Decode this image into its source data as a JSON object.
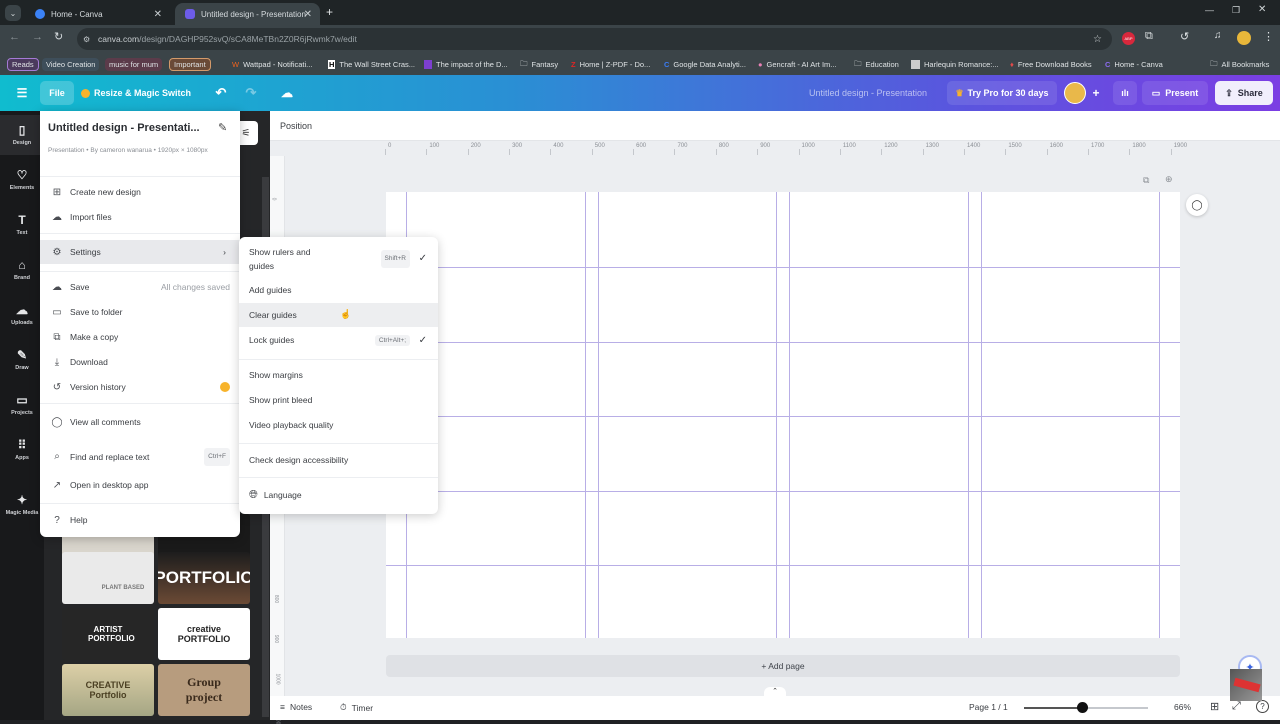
{
  "browser": {
    "tabs": [
      {
        "title": "Home - Canva",
        "active": false
      },
      {
        "title": "Untitled design - Presentation",
        "active": true
      }
    ],
    "new_tab_label": "+",
    "url_host": "canva.com",
    "url_path": "/design/DAGHP952svQ/sCA8MeTBn2Z0R6jRwmk7w/edit",
    "bookmarks_chips": [
      "Reads",
      "Video Creation",
      "music for mum",
      "Important"
    ],
    "bookmarks": [
      "Wattpad - Notificati...",
      "The Wall Street Cras...",
      "The impact of the D...",
      "Fantasy",
      "Home | Z-PDF - Do...",
      "Google Data Analyti...",
      "Gencraft - AI Art Im...",
      "Education",
      "Harlequin Romance:...",
      "Free Download Books",
      "Home - Canva"
    ],
    "all_bookmarks_label": "All Bookmarks"
  },
  "header": {
    "file_label": "File",
    "resize_label": "Resize & Magic Switch",
    "doc_title": "Untitled design - Presentation",
    "try_pro_label": "Try Pro for 30 days",
    "present_label": "Present",
    "share_label": "Share"
  },
  "rail": {
    "items": [
      {
        "label": "Design",
        "icon": "▯"
      },
      {
        "label": "Elements",
        "icon": "♡△"
      },
      {
        "label": "Text",
        "icon": "T"
      },
      {
        "label": "Brand",
        "icon": "⌂"
      },
      {
        "label": "Uploads",
        "icon": "☁"
      },
      {
        "label": "Draw",
        "icon": "✎"
      },
      {
        "label": "Projects",
        "icon": "▭"
      },
      {
        "label": "Apps",
        "icon": "⠿"
      },
      {
        "label": "Magic Media",
        "icon": "✦"
      }
    ]
  },
  "templates": [
    "PLANT BASED",
    "PORTFOLIO",
    "ARTIST PORTFOLIO",
    "creative PORTFOLIO",
    "CREATIVE Portfolio",
    "Group project"
  ],
  "file_menu": {
    "title": "Untitled design - Presentati...",
    "subtitle": "Presentation • By cameron wanarua • 1920px × 1080px",
    "items": [
      {
        "label": "Create new design",
        "icon": "⊞"
      },
      {
        "label": "Import files",
        "icon": "☁"
      },
      {
        "label": "Settings",
        "icon": "⚙"
      },
      {
        "label": "Save",
        "icon": "☁",
        "status": "All changes saved"
      },
      {
        "label": "Save to folder",
        "icon": "▭"
      },
      {
        "label": "Make a copy",
        "icon": "⧉"
      },
      {
        "label": "Download",
        "icon": "⤓"
      },
      {
        "label": "Version history",
        "icon": "↺"
      },
      {
        "label": "View all comments",
        "icon": "◯"
      },
      {
        "label": "Find and replace text",
        "icon": "⌕",
        "shortcut": "Ctrl+F"
      },
      {
        "label": "Open in desktop app",
        "icon": "↗"
      },
      {
        "label": "Help",
        "icon": "?"
      }
    ]
  },
  "settings_menu": {
    "items": [
      {
        "label": "Show rulers and guides",
        "shortcut": "Shift+R",
        "checked": true
      },
      {
        "label": "Add guides"
      },
      {
        "label": "Clear guides",
        "hovered": true
      },
      {
        "label": "Lock guides",
        "shortcut": "Ctrl+Alt+;",
        "checked": true
      },
      {
        "label": "Show margins"
      },
      {
        "label": "Show print bleed"
      },
      {
        "label": "Video playback quality"
      },
      {
        "label": "Check design accessibility"
      },
      {
        "label": "Language"
      }
    ]
  },
  "toolbar": {
    "position_label": "Position"
  },
  "ruler": {
    "h_ticks": [
      "0",
      "100",
      "200",
      "300",
      "400",
      "500",
      "600",
      "700",
      "800",
      "900",
      "1000",
      "1100",
      "1200",
      "1300",
      "1400",
      "1500",
      "1600",
      "1700",
      "1800",
      "1900"
    ],
    "v_ticks": [
      "0",
      "800",
      "900",
      "1000",
      "1100"
    ]
  },
  "canvas": {
    "add_page_label": "+ Add page",
    "guide_color": "#b8aee6"
  },
  "footer": {
    "notes_label": "Notes",
    "timer_label": "Timer",
    "page_indicator": "Page 1 / 1",
    "zoom_level": "66%",
    "zoom_fraction": 0.47
  }
}
